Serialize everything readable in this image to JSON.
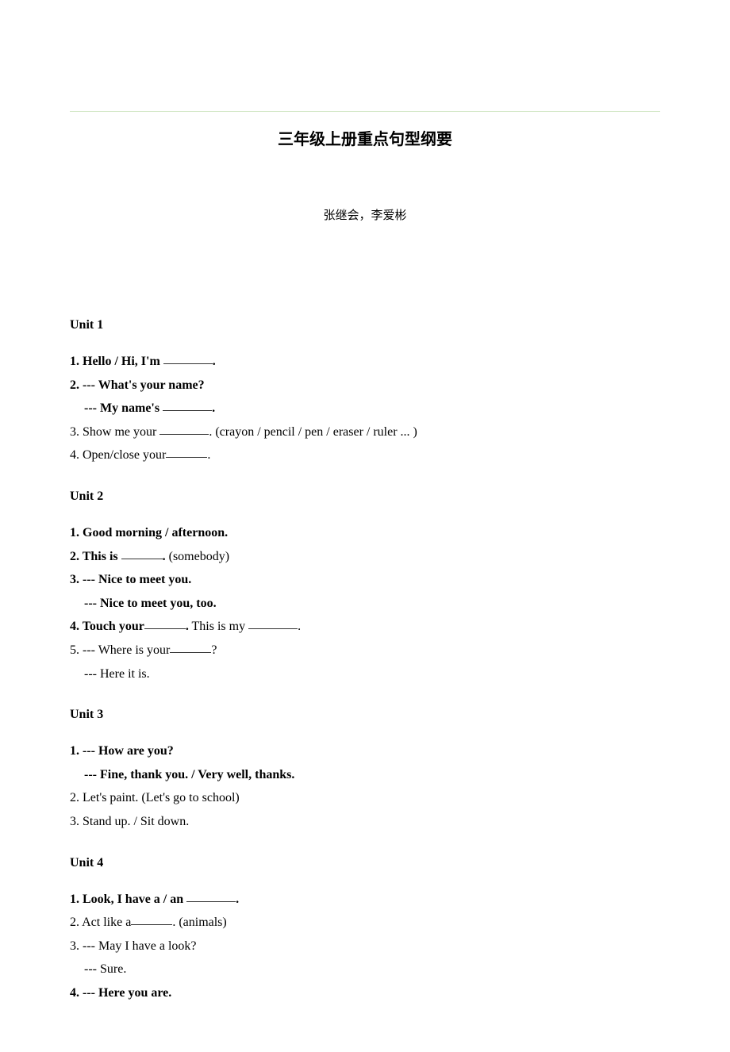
{
  "title": "三年级上册重点句型纲要",
  "authors": "张继会，李爱彬",
  "units": {
    "u1": {
      "heading": "Unit 1",
      "l1a": "1. Hello / Hi, I'm ",
      "l1b": ".",
      "l2": "2. --- What's your name?",
      "l3a": "--- My name's ",
      "l3b": ".",
      "l4a": "3. Show me your ",
      "l4b": ". (crayon / pencil / pen / eraser / ruler ... )",
      "l5a": "4. Open/close your",
      "l5b": "."
    },
    "u2": {
      "heading": "Unit 2",
      "l1": "1. Good morning / afternoon.",
      "l2a": "2. This is ",
      "l2b": ".",
      "l2c": " (somebody)",
      "l3": "3. --- Nice to meet you.",
      "l4": "--- Nice to meet you, too.",
      "l5a": "4. Touch your",
      "l5b": ".",
      "l5c": " This is my ",
      "l5d": ".",
      "l6a": "5. --- Where is your",
      "l6b": "?",
      "l7": "--- Here it is."
    },
    "u3": {
      "heading": "Unit 3",
      "l1": "1. --- How are you?",
      "l2": "--- Fine, thank you. / Very well, thanks.",
      "l3": "2. Let's paint. (Let's go to school)",
      "l4": "3. Stand up. / Sit down."
    },
    "u4": {
      "heading": "Unit 4",
      "l1a": "1. Look, I have a / an ",
      "l1b": ".",
      "l2a": "2. Act like a",
      "l2b": ". (animals)",
      "l3": "3. --- May I have a look?",
      "l4": "--- Sure.",
      "l5": "4. --- Here you are."
    }
  }
}
